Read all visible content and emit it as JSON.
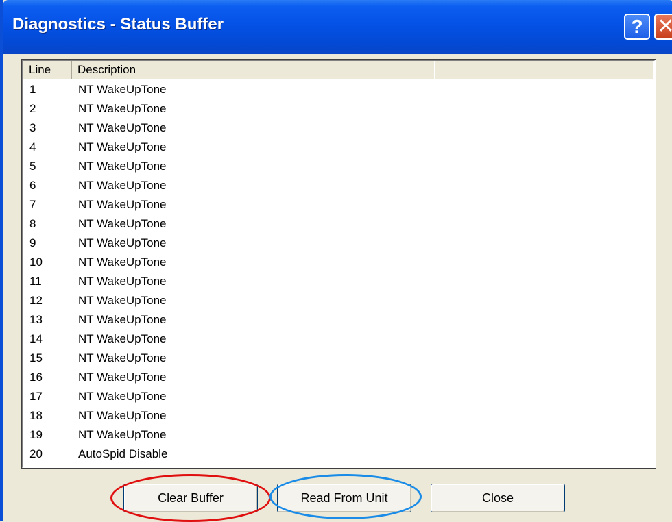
{
  "window": {
    "title": "Diagnostics - Status Buffer"
  },
  "titlebar": {
    "help_label": "?",
    "close_label": "✕"
  },
  "list": {
    "columns": [
      "Line",
      "Description",
      ""
    ],
    "rows": [
      {
        "line": "1",
        "description": "NT WakeUpTone"
      },
      {
        "line": "2",
        "description": "NT WakeUpTone"
      },
      {
        "line": "3",
        "description": "NT WakeUpTone"
      },
      {
        "line": "4",
        "description": "NT WakeUpTone"
      },
      {
        "line": "5",
        "description": "NT WakeUpTone"
      },
      {
        "line": "6",
        "description": "NT WakeUpTone"
      },
      {
        "line": "7",
        "description": "NT WakeUpTone"
      },
      {
        "line": "8",
        "description": "NT WakeUpTone"
      },
      {
        "line": "9",
        "description": "NT WakeUpTone"
      },
      {
        "line": "10",
        "description": "NT WakeUpTone"
      },
      {
        "line": "11",
        "description": "NT WakeUpTone"
      },
      {
        "line": "12",
        "description": "NT WakeUpTone"
      },
      {
        "line": "13",
        "description": "NT WakeUpTone"
      },
      {
        "line": "14",
        "description": "NT WakeUpTone"
      },
      {
        "line": "15",
        "description": "NT WakeUpTone"
      },
      {
        "line": "16",
        "description": "NT WakeUpTone"
      },
      {
        "line": "17",
        "description": "NT WakeUpTone"
      },
      {
        "line": "18",
        "description": "NT WakeUpTone"
      },
      {
        "line": "19",
        "description": "NT WakeUpTone"
      },
      {
        "line": "20",
        "description": "AutoSpid Disable"
      }
    ]
  },
  "buttons": {
    "clear": "Clear Buffer",
    "read": "Read From Unit",
    "close": "Close"
  },
  "annotations": {
    "clear_color": "#e01010",
    "read_color": "#1a8ce8"
  }
}
